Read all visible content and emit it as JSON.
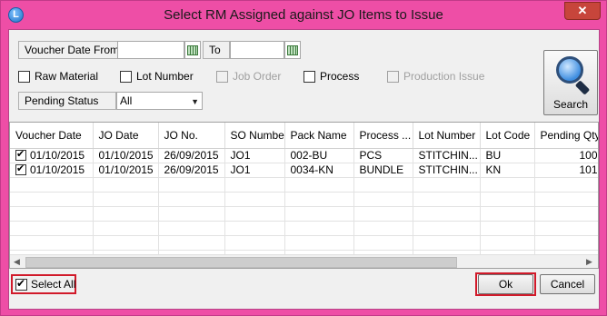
{
  "window": {
    "title": "Select RM Assigned against JO Items to Issue",
    "close_glyph": "✕",
    "app_icon_glyph": "L"
  },
  "filters": {
    "voucher_date_from_label": "Voucher Date From",
    "voucher_date_from_value": "",
    "to_label": "To",
    "to_value": "",
    "raw_material_label": "Raw Material",
    "lot_number_label": "Lot Number",
    "job_order_label": "Job Order",
    "process_label": "Process",
    "production_issue_label": "Production Issue",
    "pending_status_label": "Pending Status",
    "pending_status_value": "All",
    "search_label": "Search"
  },
  "grid": {
    "columns": [
      "Voucher Date",
      "JO Date",
      "JO No.",
      "SO Number",
      "Pack Name",
      "Process ...",
      "Lot Number",
      "Lot Code",
      "Pending Qty"
    ],
    "rows": [
      [
        "01/10/2015",
        "01/10/2015",
        "26/09/2015",
        "JO1",
        "002-BU",
        "PCS",
        "STITCHIN...",
        "BU",
        "100"
      ],
      [
        "01/10/2015",
        "01/10/2015",
        "26/09/2015",
        "JO1",
        "0034-KN",
        "BUNDLE",
        "STITCHIN...",
        "KN",
        "101"
      ]
    ]
  },
  "footer": {
    "select_all_label": "Select All",
    "ok_label": "Ok",
    "cancel_label": "Cancel"
  },
  "colors": {
    "window_frame": "#ee4ea6",
    "highlight_border": "#d11a2a",
    "close_button": "#c7453b"
  }
}
